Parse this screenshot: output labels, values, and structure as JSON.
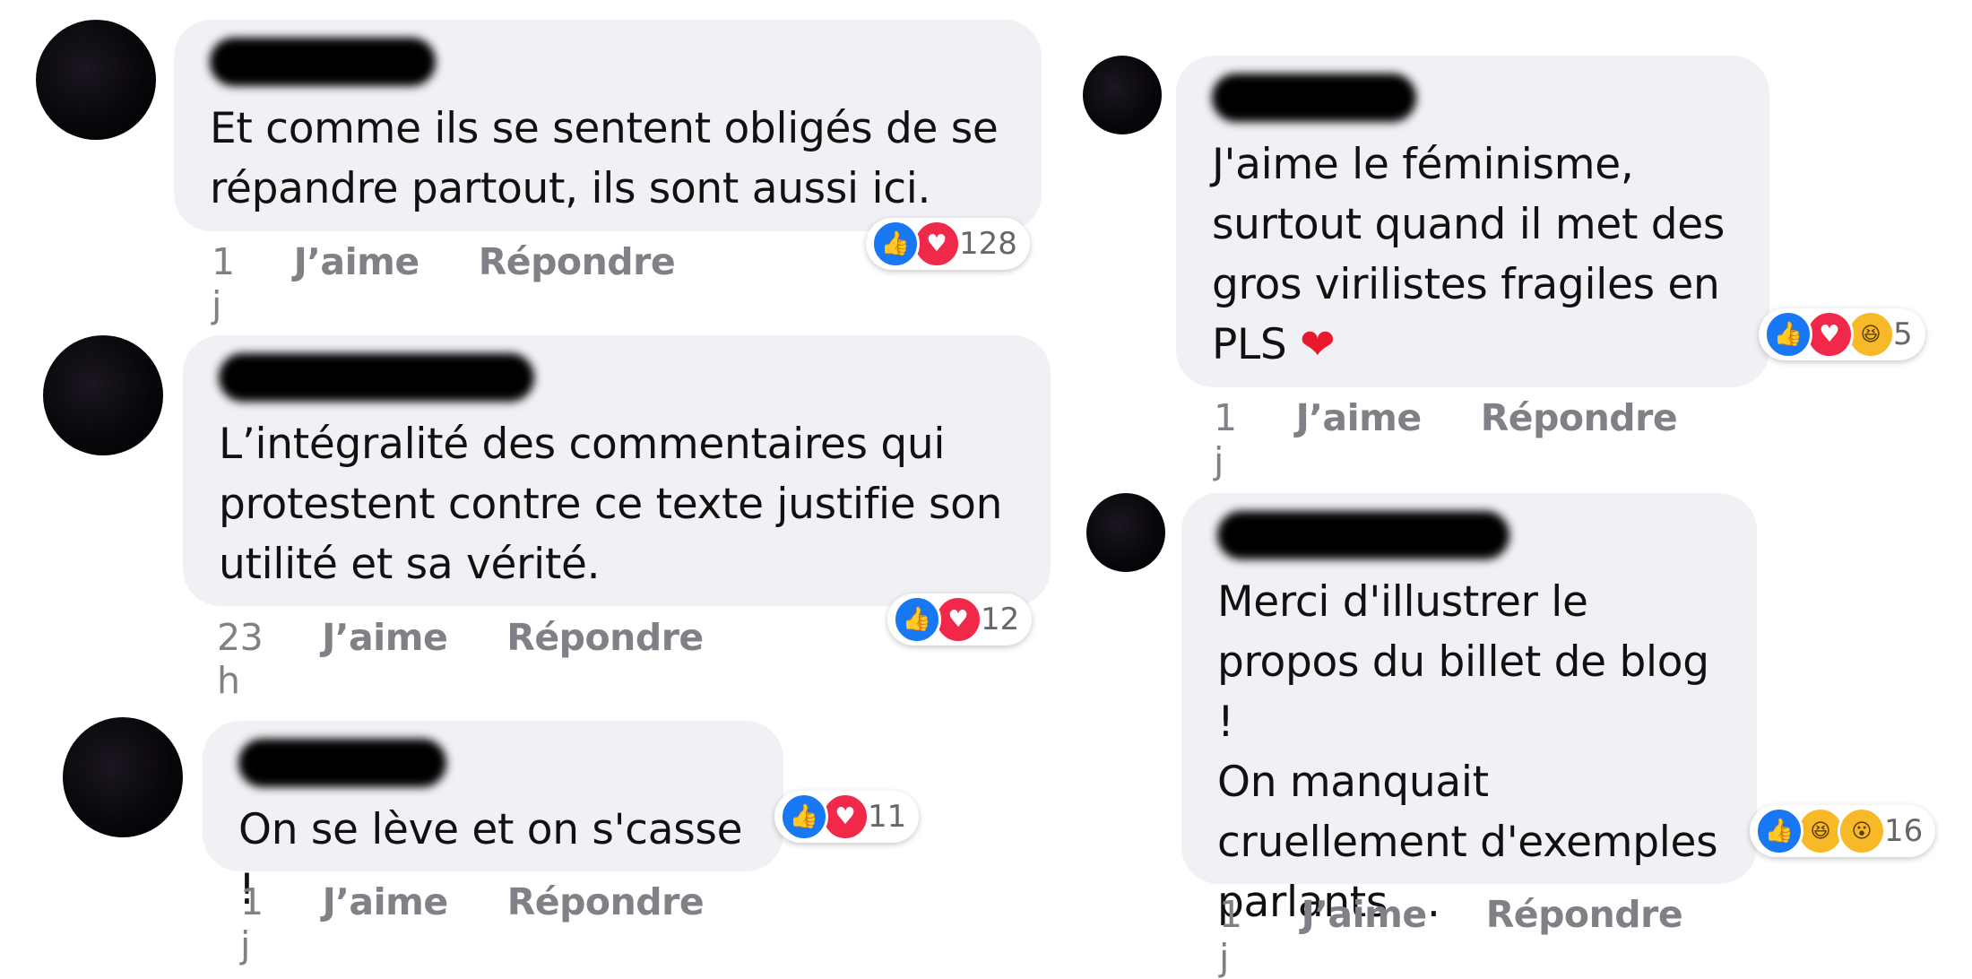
{
  "comments": [
    {
      "text": "Et comme ils se sentent obligés de se\nrépandre partout, ils sont aussi ici.",
      "time": "1 j",
      "like": "J’aime",
      "reply": "Répondre",
      "reaction_count": "128"
    },
    {
      "text": "L’intégralité des commentaires qui\nprotestent contre ce texte justifie son\nutilité et sa vérité.",
      "time": "23 h",
      "like": "J’aime",
      "reply": "Répondre",
      "reaction_count": "12"
    },
    {
      "text": "On se lève et on s'casse !",
      "time": "1 j",
      "like": "J’aime",
      "reply": "Répondre",
      "reaction_count": "11"
    },
    {
      "text": "J'aime le féminisme,\nsurtout quand il met des\ngros virilistes fragiles en\nPLS",
      "emoji": "❤",
      "time": "1 j",
      "like": "J’aime",
      "reply": "Répondre",
      "reaction_count": "5"
    },
    {
      "text": "Merci d'illustrer le\npropos du billet de blog !\nOn manquait\ncruellement d'exemples\nparlants ...",
      "time": "1 j",
      "like": "J’aime",
      "reply": "Répondre",
      "reaction_count": "16"
    }
  ],
  "icons": {
    "like": "👍",
    "love": "♥",
    "haha": "😆",
    "wow": "😮"
  },
  "colors": {
    "bubble": "#f0f1f5",
    "like": "#1877f2",
    "love": "#f0284a",
    "haha": "#f7b928",
    "meta": "#7f8187"
  }
}
